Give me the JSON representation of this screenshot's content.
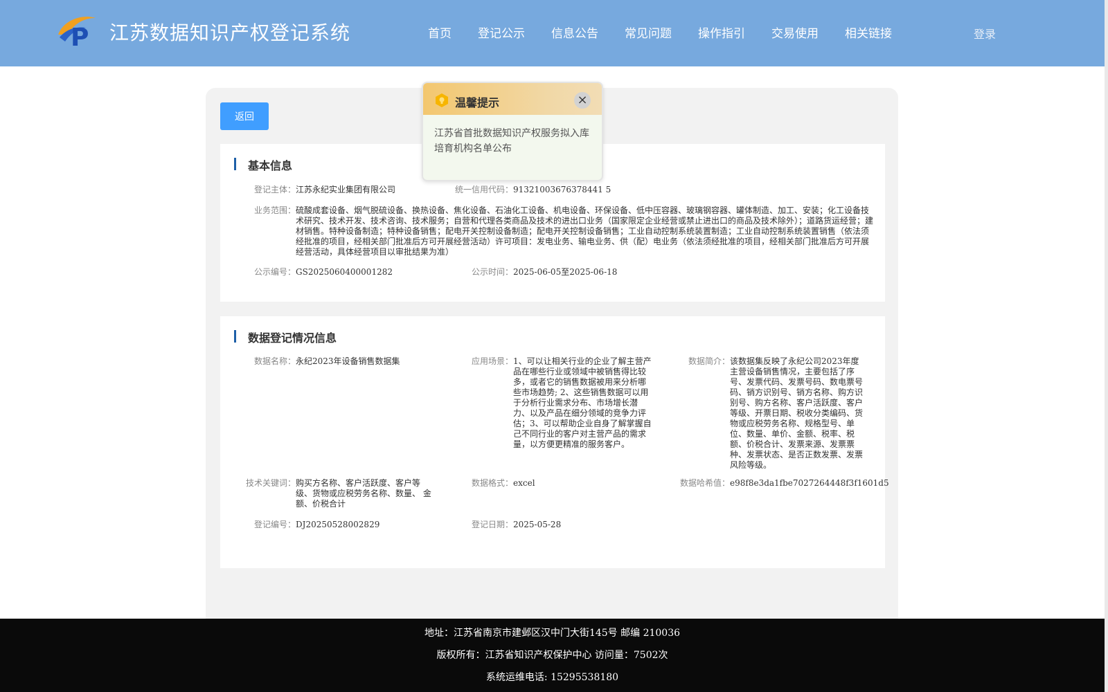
{
  "header": {
    "site_title": "江苏数据知识产权登记系统",
    "nav": [
      "首页",
      "登记公示",
      "信息公告",
      "常见问题",
      "操作指引",
      "交易使用",
      "相关链接"
    ],
    "login": "登录",
    "logo_letter": "P"
  },
  "back_button": "返回",
  "basic_info": {
    "title": "基本信息",
    "registrant_label": "登记主体：",
    "registrant_value": "江苏永纪实业集团有限公司",
    "credit_code_label": "统一信用代码：",
    "credit_code_value": "91321003676378441 5",
    "business_scope_label": "业务范围：",
    "business_scope_value": "硫酸成套设备、烟气脱硫设备、换热设备、焦化设备、石油化工设备、机电设备、环保设备、低中压容器、玻璃钢容器、罐体制造、加工、安装；化工设备技术研究、技术开发、技术咨询、技术服务；自营和代理各类商品及技术的进出口业务（国家限定企业经营或禁止进出口的商品及技术除外）；道路货运经营；建材销售。特种设备制造；特种设备销售；配电开关控制设备制造；配电开关控制设备销售；工业自动控制系统装置制造；工业自动控制系统装置销售（依法须经批准的项目，经相关部门批准后方可开展经营活动）许可项目：发电业务、输电业务、供（配）电业务（依法须经批准的项目，经相关部门批准后方可开展经营活动，具体经营项目以审批结果为准）",
    "notice_no_label": "公示编号：",
    "notice_no_value": "GS2025060400001282",
    "notice_time_label": "公示时间：",
    "notice_time_value": "2025-06-05至2025-06-18"
  },
  "data_info": {
    "title": "数据登记情况信息",
    "data_name_label": "数据名称：",
    "data_name_value": "永纪2023年设备销售数据集",
    "scenario_label": "应用场景：",
    "scenario_value": "1、可以让相关行业的企业了解主营产品在哪些行业或领域中被销售得比较多，或者它的销售数据被用来分析哪些市场趋势; 2、这些销售数据可以用于分析行业需求分布、市场增长潜力、以及产品在细分领域的竞争力评估；3、可以帮助企业自身了解掌握自己不同行业的客户对主营产品的需求量，以方便更精准的服务客户。",
    "intro_label": "数据简介：",
    "intro_value": "该数据集反映了永纪公司2023年度主营设备销售情况，主要包括了序号、发票代码、发票号码、数电票号码、销方识别号、销方名称、购方识别号、购方名称、客户活跃度、客户等级、开票日期、税收分类编码、货物或应税劳务名称、规格型号、单位、数量、单价、金额、税率、税额、价税合计、发票来源、发票票种、发票状态、是否正数发票、发票风险等级。",
    "keywords_label": "技术关键词：",
    "keywords_value": "购买方名称、客户活跃度、客户等级、货物或应税劳务名称、数量、 金额、价税合计",
    "format_label": "数据格式：",
    "format_value": "excel",
    "hash_label": "数据哈希值：",
    "hash_value": "e98f8e3da1fbe7027264448f3f1601d5",
    "reg_no_label": "登记编号：",
    "reg_no_value": "DJ20250528002829",
    "reg_date_label": "登记日期：",
    "reg_date_value": "2025-05-28"
  },
  "footer": {
    "address": "地址：江苏省南京市建邺区汉中门大街145号 邮编 210036",
    "copyright": "版权所有：江苏省知识产权保护中心 访问量：7502次",
    "phone": "系统运维电话: 15295538180"
  },
  "popup": {
    "title": "温馨提示",
    "body": "江苏省首批数据知识产权服务拟入库培育机构名单公布",
    "close": "×"
  },
  "colors": {
    "header_bg": "#77a9de",
    "primary_button": "#409eff",
    "accent_bar": "#1e5fa8",
    "footer_bg": "#0a0a0a"
  },
  "icons": {
    "logo": "logo-icon",
    "popup": "bulb-icon",
    "close": "close-icon"
  }
}
